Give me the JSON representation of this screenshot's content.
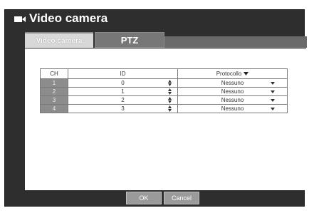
{
  "window": {
    "title": "Video camera"
  },
  "tabs": [
    {
      "label": "Video camera",
      "active": true
    },
    {
      "label": "PTZ",
      "active": false
    }
  ],
  "table": {
    "headers": {
      "ch": "CH",
      "id": "ID",
      "protocol": "Protocollo"
    },
    "rows": [
      {
        "ch": "1",
        "id": "0",
        "protocol": "Nessuno"
      },
      {
        "ch": "2",
        "id": "1",
        "protocol": "Nessuno"
      },
      {
        "ch": "3",
        "id": "2",
        "protocol": "Nessuno"
      },
      {
        "ch": "4",
        "id": "3",
        "protocol": "Nessuno"
      }
    ]
  },
  "buttons": {
    "ok": "OK",
    "cancel": "Cancel"
  },
  "icons": {
    "title": "video-camera-icon",
    "spinner": "up-down-spinner-icon",
    "dropdown": "chevron-down-icon"
  },
  "colors": {
    "window_bg": "#2e2e2e",
    "header_cell": "#8c8c8c",
    "button": "#9a9a9a"
  }
}
